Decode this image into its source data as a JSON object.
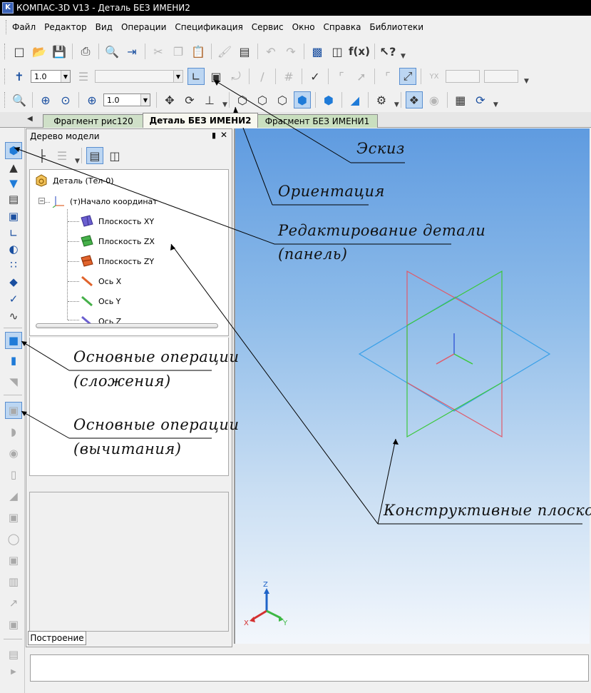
{
  "window": {
    "title": "КОМПАС-3D V13 - Деталь БЕЗ ИМЕНИ2",
    "app_icon": "kompas-logo-icon"
  },
  "menu": [
    {
      "label": "Файл"
    },
    {
      "label": "Редактор"
    },
    {
      "label": "Вид"
    },
    {
      "label": "Операции"
    },
    {
      "label": "Спецификация"
    },
    {
      "label": "Сервис"
    },
    {
      "label": "Окно"
    },
    {
      "label": "Справка"
    },
    {
      "label": "Библиотеки"
    }
  ],
  "toolbar_standard": {
    "fx_label": "f(x)",
    "icons": [
      "new-document-icon",
      "open-folder-icon",
      "save-icon",
      "print-icon",
      "preview-icon",
      "insert-icon",
      "cut-icon",
      "copy-icon",
      "paste-icon",
      "format-brush-icon",
      "properties-icon",
      "undo-icon",
      "redo-icon",
      "manager-icon",
      "library-icon",
      "variables-icon",
      "help-icon"
    ]
  },
  "toolbar_current_state": {
    "step_value": "1.0",
    "layer_value": "",
    "coord_x": "",
    "coord_y": ""
  },
  "toolbar_view": {
    "zoom_value": "1.0"
  },
  "tabs": [
    {
      "label": "Фрагмент рис120",
      "active": false
    },
    {
      "label": "Деталь БЕЗ ИМЕНИ2",
      "active": true
    },
    {
      "label": "Фрагмент БЕЗ ИМЕНИ1",
      "active": false
    }
  ],
  "model_tree": {
    "title": "Дерево модели",
    "root": "Деталь (Тел-0)",
    "origin": "(т)Начало координат",
    "items": [
      {
        "label": "Плоскость XY",
        "color": "#6b5fcf"
      },
      {
        "label": "Плоскость ZX",
        "color": "#46b04a"
      },
      {
        "label": "Плоскость ZY",
        "color": "#e0632c"
      },
      {
        "label": "Ось X",
        "color": "#e0632c"
      },
      {
        "label": "Ось Y",
        "color": "#46b04a"
      },
      {
        "label": "Ось Z",
        "color": "#6b5fcf"
      }
    ],
    "bottom_tab": "Построение"
  },
  "viewport": {
    "triad": {
      "z": "Z",
      "x": "X",
      "y": "Y"
    },
    "colors": {
      "plane_xy": "#3aa0e8",
      "plane_zx": "#e05a6a",
      "plane_zy": "#3cc83c"
    }
  },
  "annotations": {
    "sketch": "Эскиз",
    "orientation": "Ориентация",
    "edit_part_1": "Редактирование детали",
    "edit_part_2": "(панель)",
    "extrude_ops_1": "Основные операции",
    "extrude_ops_2": "(сложения)",
    "cut_ops_1": "Основные операции",
    "cut_ops_2": "(вычитания)",
    "planes": "Конструктивные плоскости"
  }
}
